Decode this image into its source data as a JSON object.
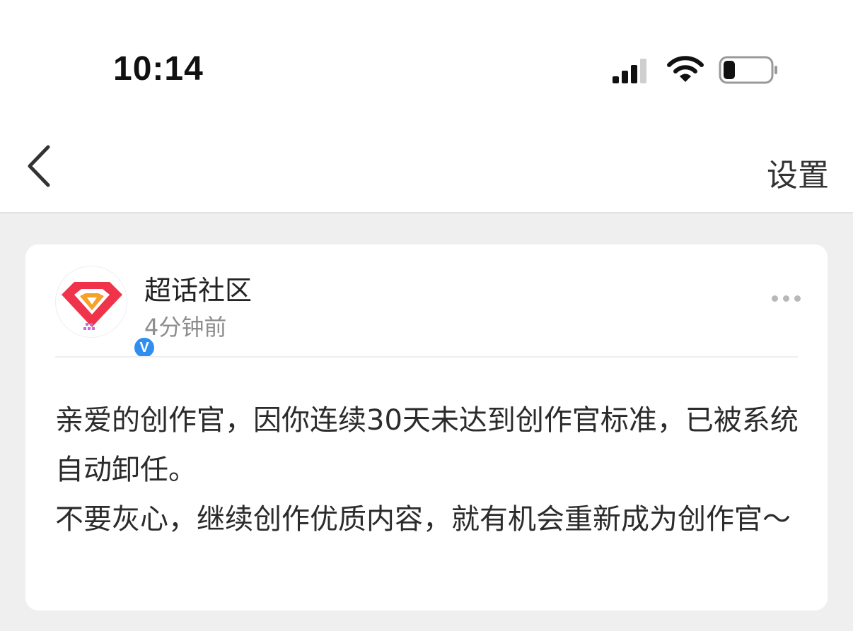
{
  "status_bar": {
    "time": "10:14",
    "icons": [
      "signal-icon",
      "wifi-icon",
      "battery-icon"
    ]
  },
  "nav": {
    "back_icon": "chevron-left-icon",
    "settings_label": "设置"
  },
  "post": {
    "author": "超话社区",
    "time_ago": "4分钟前",
    "verified_badge": "V",
    "more_icon": "ellipsis-icon",
    "message_lines": [
      "亲爱的创作官，因你连续30天未达到创作官标准，已被系统自动卸任。",
      "不要灰心，继续创作优质内容，就有机会重新成为创作官～"
    ]
  },
  "colors": {
    "accent": "#2f8ff0",
    "logo_red": "#f0334a",
    "logo_orange": "#f7a02a",
    "page_bg": "#efeff0"
  }
}
